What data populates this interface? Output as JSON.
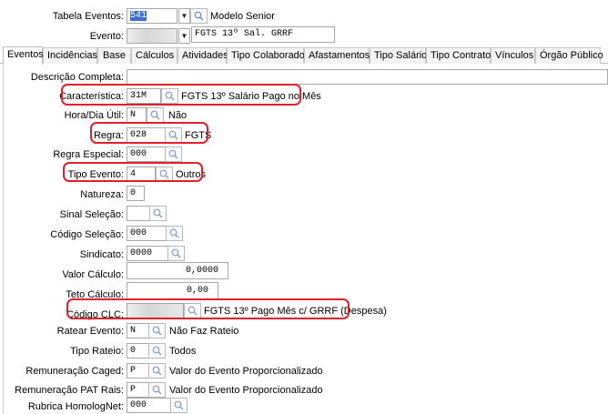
{
  "header": {
    "tabela_label": "Tabela Eventos:",
    "tabela_value": "541",
    "tabela_desc": "Modelo Senior",
    "evento_label": "Evento:",
    "evento_desc": "FGTS 13º Sal. GRRF"
  },
  "tabs": [
    "Eventos",
    "Incidências",
    "Base",
    "Cálculos",
    "Atividades",
    "Tipo Colaborador",
    "Afastamentos",
    "Tipo Salário",
    "Tipo Contrato",
    "Vínculos",
    "Órgão Público"
  ],
  "form": {
    "descricao": {
      "label": "Descrição Completa:",
      "value": ""
    },
    "caracteristica": {
      "label": "Característica:",
      "value": "31M",
      "desc": "FGTS 13º Salário Pago no Mês"
    },
    "hora_dia": {
      "label": "Hora/Dia Útil:",
      "value": "N",
      "desc": "Não"
    },
    "regra": {
      "label": "Regra:",
      "value": "028",
      "desc": "FGTS"
    },
    "regra_especial": {
      "label": "Regra Especial:",
      "value": "000"
    },
    "tipo_evento": {
      "label": "Tipo Evento:",
      "value": "4",
      "desc": "Outros"
    },
    "natureza": {
      "label": "Natureza:",
      "value": "0"
    },
    "sinal_selecao": {
      "label": "Sinal Seleção:",
      "value": ""
    },
    "codigo_selecao": {
      "label": "Código Seleção:",
      "value": "000"
    },
    "sindicato": {
      "label": "Sindicato:",
      "value": "0000"
    },
    "valor_calculo": {
      "label": "Valor Cálculo:",
      "value": "0,0000"
    },
    "teto_calculo": {
      "label": "Teto Cálculo:",
      "value": "0,00"
    },
    "codigo_clc": {
      "label": "Código CLC:",
      "desc": "FGTS 13º Pago Mês c/ GRRF (Despesa)"
    },
    "ratear_evento": {
      "label": "Ratear Evento:",
      "value": "N",
      "desc": "Não Faz Rateio"
    },
    "tipo_rateio": {
      "label": "Tipo Rateio:",
      "value": "0",
      "desc": "Todos"
    },
    "rem_caged": {
      "label": "Remuneração Caged:",
      "value": "P",
      "desc": "Valor do Evento Proporcionalizado"
    },
    "rem_pat": {
      "label": "Remuneração PAT Rais:",
      "value": "P",
      "desc": "Valor do Evento Proporcionalizado"
    },
    "rubrica": {
      "label": "Rubrica HomologNet:",
      "value": "000"
    }
  },
  "colors": {
    "highlight": "#e0202c",
    "selection": "#3a6fd0"
  },
  "icons": {
    "lookup": "magnifier-icon",
    "dropdown": "dropdown-arrow-icon"
  }
}
